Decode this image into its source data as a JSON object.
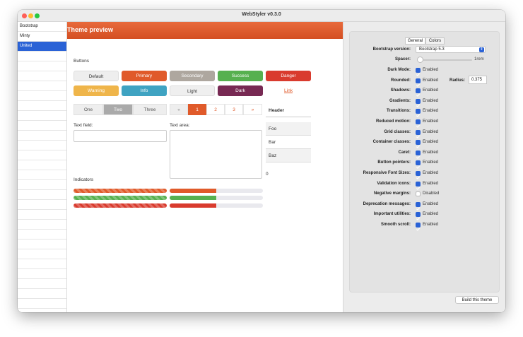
{
  "window": {
    "title": "WebStyler v0.3.0"
  },
  "sidebar": {
    "items": [
      {
        "label": "Bootstrap",
        "selected": false
      },
      {
        "label": "Minty",
        "selected": false
      },
      {
        "label": "United",
        "selected": true
      }
    ]
  },
  "preview": {
    "header": "Theme preview",
    "buttons_label": "Buttons",
    "buttons": [
      "Default",
      "Primary",
      "Secondary",
      "Success",
      "Danger",
      "Warning",
      "Info",
      "Light",
      "Dark",
      "Link"
    ],
    "segments": [
      "One",
      "Two",
      "Three"
    ],
    "pagination": [
      "«",
      "1",
      "2",
      "3",
      "»"
    ],
    "text_field_label": "Text field:",
    "text_area_label": "Text area:",
    "indicators_label": "Indicators",
    "table": {
      "header": "Header",
      "rows": [
        "Foo",
        "Bar",
        "Baz"
      ]
    },
    "spinner_value": "0",
    "progress": [
      {
        "color": "#e05a2a",
        "value": 1.0,
        "style": "striped"
      },
      {
        "color": "#56b04f",
        "value": 1.0,
        "style": "striped"
      },
      {
        "color": "#d93b2e",
        "value": 1.0,
        "style": "striped"
      },
      {
        "color": "#e05a2a",
        "value": 0.5,
        "style": "solid"
      },
      {
        "color": "#56b04f",
        "value": 0.5,
        "style": "solid"
      },
      {
        "color": "#d93b2e",
        "value": 0.5,
        "style": "solid"
      }
    ]
  },
  "settings": {
    "tabs": [
      "General",
      "Colors"
    ],
    "version_label": "Bootstrap version:",
    "version_value": "Bootstrap 5.3",
    "spacer_label": "Spacer:",
    "spacer_value": "1rem",
    "radius_label": "Radius:",
    "radius_value": "0.375",
    "options": [
      {
        "label": "Dark Mode:",
        "checked": true,
        "text": "Enabled"
      },
      {
        "label": "Rounded:",
        "checked": true,
        "text": "Enabled"
      },
      {
        "label": "Shadows:",
        "checked": true,
        "text": "Enabled"
      },
      {
        "label": "Gradients:",
        "checked": true,
        "text": "Enabled"
      },
      {
        "label": "Transitions:",
        "checked": true,
        "text": "Enabled"
      },
      {
        "label": "Reduced motion:",
        "checked": true,
        "text": "Enabled"
      },
      {
        "label": "Grid classes:",
        "checked": true,
        "text": "Enabled"
      },
      {
        "label": "Container classes:",
        "checked": true,
        "text": "Enabled"
      },
      {
        "label": "Caret:",
        "checked": true,
        "text": "Enabled"
      },
      {
        "label": "Button pointers:",
        "checked": true,
        "text": "Enabled"
      },
      {
        "label": "Responsive Font Sizes:",
        "checked": true,
        "text": "Enabled"
      },
      {
        "label": "Validation icons:",
        "checked": true,
        "text": "Enabled"
      },
      {
        "label": "Negative margins:",
        "checked": false,
        "text": "Disabled"
      },
      {
        "label": "Deprecation messages:",
        "checked": true,
        "text": "Enabled"
      },
      {
        "label": "Important utilities:",
        "checked": true,
        "text": "Enabled"
      },
      {
        "label": "Smooth scroll:",
        "checked": true,
        "text": "Enabled"
      }
    ],
    "build_label": "Build this theme"
  }
}
